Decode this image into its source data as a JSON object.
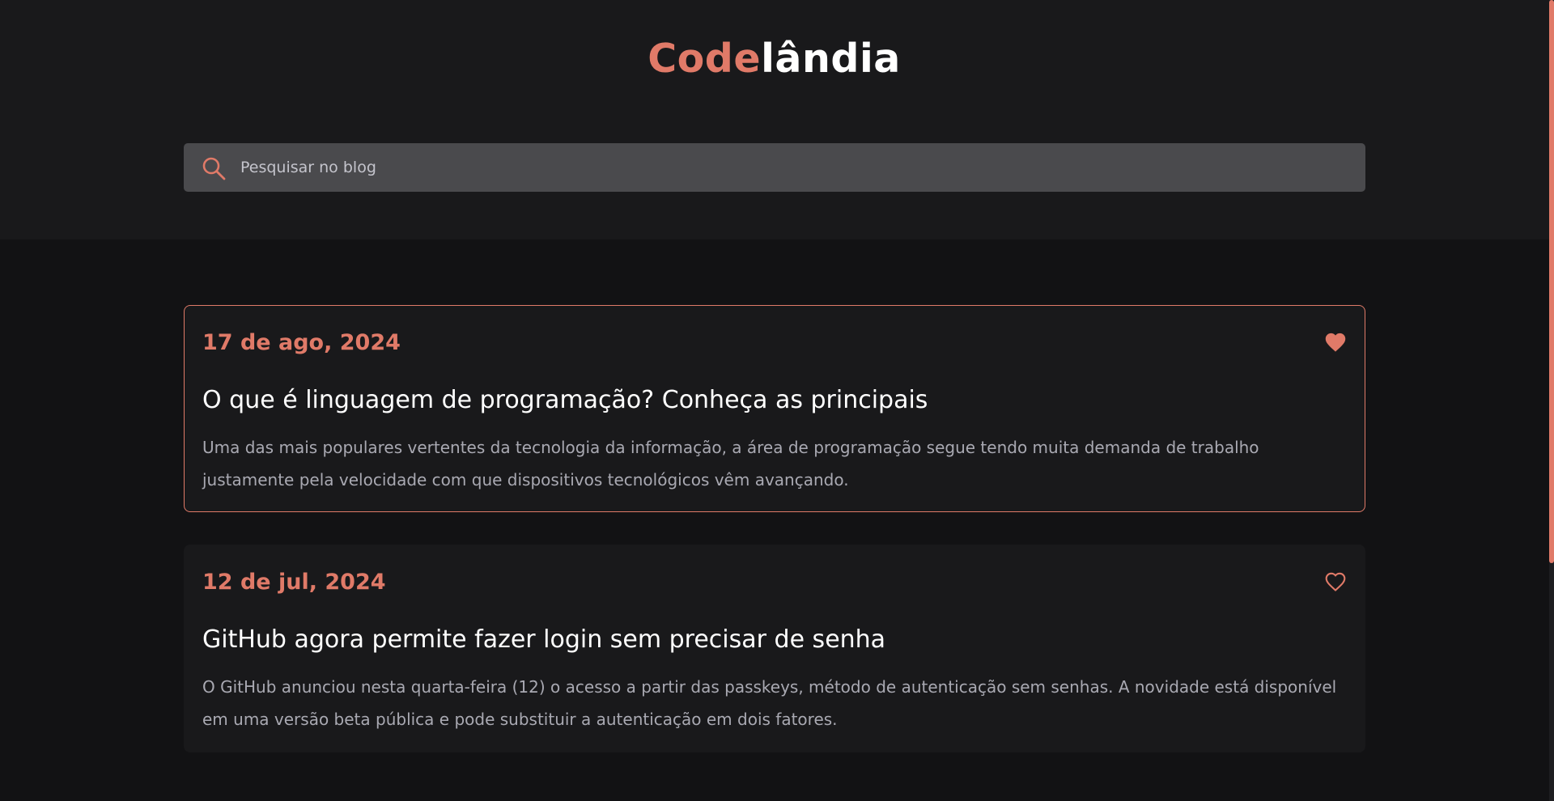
{
  "brand": {
    "accent": "Code",
    "rest": "lândia"
  },
  "search": {
    "placeholder": "Pesquisar no blog",
    "icon": "search-icon"
  },
  "posts": [
    {
      "date": "17 de ago, 2024",
      "title": "O que é linguagem de programação? Conheça as principais",
      "excerpt": "Uma das mais populares vertentes da tecnologia da informação, a área de programação segue tendo muita demanda de trabalho justamente pela velocidade com que dispositivos tecnológicos vêm avançando.",
      "liked": true
    },
    {
      "date": "12 de jul, 2024",
      "title": "GitHub agora permite fazer login sem precisar de senha",
      "excerpt": "O GitHub anunciou nesta quarta-feira (12) o acesso a partir das passkeys, método de autenticação sem senhas. A novidade está disponível em uma versão beta pública e pode substituir a autenticação em dois fatores.",
      "liked": false
    }
  ],
  "colors": {
    "accent": "#e07a68",
    "background": "#121214",
    "surface": "#19191b",
    "input": "#4a4a4d"
  }
}
